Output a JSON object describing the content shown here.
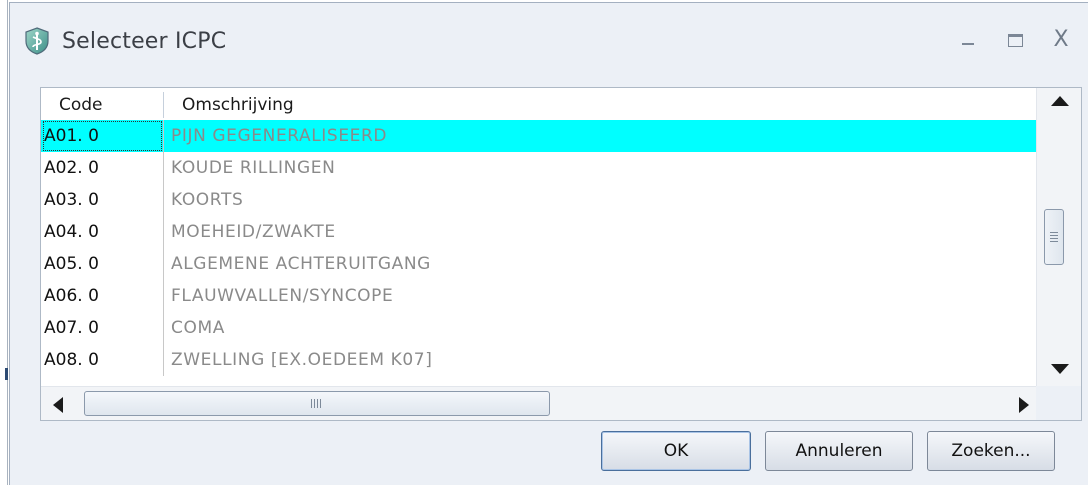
{
  "window": {
    "title": "Selecteer ICPC",
    "controls": {
      "minimize": "_",
      "maximize": "□",
      "close": "X"
    }
  },
  "grid": {
    "columns": [
      "Code",
      "Omschrijving"
    ],
    "rows": [
      {
        "code": "A01.  0",
        "desc": "PIJN GEGENERALISEERD",
        "selected": true
      },
      {
        "code": "A02.  0",
        "desc": "KOUDE RILLINGEN"
      },
      {
        "code": "A03.  0",
        "desc": "KOORTS"
      },
      {
        "code": "A04.  0",
        "desc": "MOEHEID/ZWAKTE"
      },
      {
        "code": "A05.  0",
        "desc": "ALGEMENE ACHTERUITGANG"
      },
      {
        "code": "A06.  0",
        "desc": "FLAUWVALLEN/SYNCOPE"
      },
      {
        "code": "A07.  0",
        "desc": "COMA"
      },
      {
        "code": "A08.  0",
        "desc": "ZWELLING [EX.OEDEEM K07]"
      }
    ],
    "selection_color": "#00ffff"
  },
  "buttons": {
    "ok": "OK",
    "cancel": "Annuleren",
    "search": "Zoeken..."
  },
  "icons": {
    "app": "shield-caduceus-icon",
    "scroll_up": "arrow-up-icon",
    "scroll_down": "arrow-down-icon",
    "scroll_left": "arrow-left-icon",
    "scroll_right": "arrow-right-icon"
  }
}
